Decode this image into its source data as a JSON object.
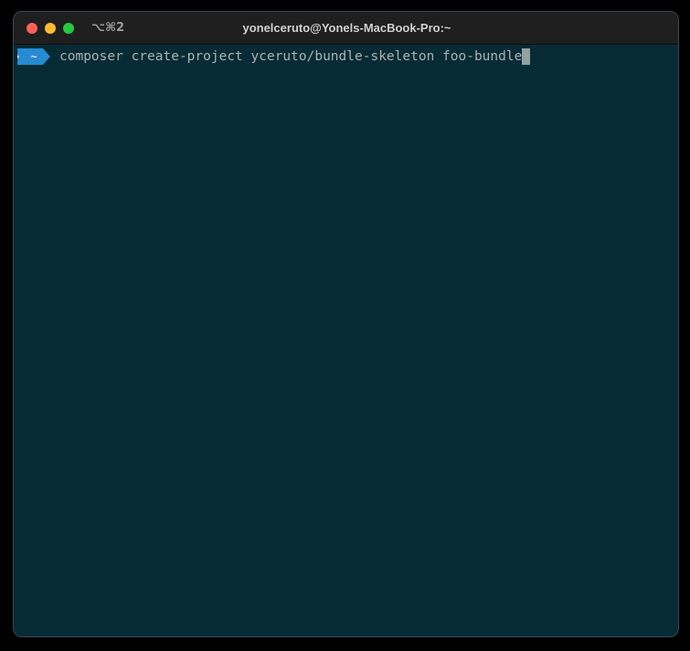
{
  "window": {
    "title": "yonelceruto@Yonels-MacBook-Pro:~",
    "tab_shortcut": "⌥⌘2"
  },
  "terminal": {
    "prompt": {
      "directory": "~",
      "segment_color": "#268bd2"
    },
    "command": "composer create-project yceruto/bundle-skeleton foo-bundle",
    "background": "#072b35",
    "foreground": "#a8b2b4"
  }
}
